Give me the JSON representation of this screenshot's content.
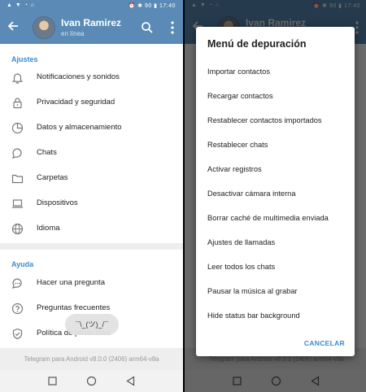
{
  "status": {
    "left_icons": "▲ ▼ ◔ ⌂",
    "right_text": "⏰ ✱ 90 ▮ 17:40"
  },
  "header": {
    "name": "Ivan Ramirez",
    "subtitle": "en línea"
  },
  "settings": {
    "section_title": "Ajustes",
    "items": [
      {
        "label": "Notificaciones y sonidos",
        "icon": "bell-icon"
      },
      {
        "label": "Privacidad y seguridad",
        "icon": "lock-icon"
      },
      {
        "label": "Datos y almacenamiento",
        "icon": "pie-chart-icon"
      },
      {
        "label": "Chats",
        "icon": "chat-bubble-icon"
      },
      {
        "label": "Carpetas",
        "icon": "folder-icon"
      },
      {
        "label": "Dispositivos",
        "icon": "laptop-icon"
      },
      {
        "label": "Idioma",
        "icon": "globe-icon"
      }
    ]
  },
  "help": {
    "section_title": "Ayuda",
    "items": [
      {
        "label": "Hacer una pregunta",
        "icon": "chat-dots-icon"
      },
      {
        "label": "Preguntas frecuentes",
        "icon": "question-icon"
      },
      {
        "label": "Política de privacidad",
        "icon": "shield-check-icon"
      }
    ]
  },
  "toast": "¯\\_(ツ)_/¯",
  "version": "Telegram para Android v8.0.0 (2406) arm64-v8a",
  "dialog": {
    "title": "Menú de depuración",
    "options": [
      "Importar contactos",
      "Recargar contactos",
      "Restablecer contactos importados",
      "Restablecer chats",
      "Activar registros",
      "Desactivar cámara interna",
      "Borrar caché de multimedia enviada",
      "Ajustes de llamadas",
      "Leer todos los chats",
      "Pausar la música al grabar",
      "Hide status bar background"
    ],
    "cancel": "CANCELAR"
  }
}
